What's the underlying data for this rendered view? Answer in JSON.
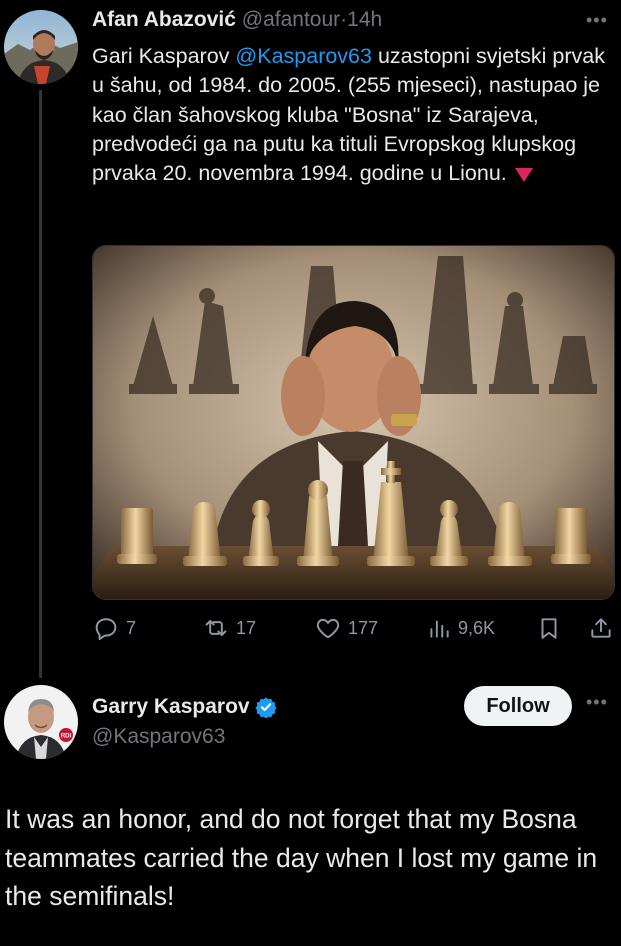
{
  "tweet1": {
    "author_name": "Afan Abazović",
    "handle": "@afantour",
    "separator": "·",
    "time": "14h",
    "more_icon": "ellipsis-icon",
    "text_before_mention": "Gari Kasparov ",
    "mention": "@Kasparov63",
    "text_after_mention": " uzastopni svjetski prvak u šahu, od 1984. do 2005. (255 mjeseci), nastupao je kao član šahovskog kluba \"Bosna\" iz Sarajeva, predvodeći ga na putu ka tituli Evropskog klupskog prvaka 20. novembra 1994. godine u Lionu.",
    "emoji": "red-triangle-down-icon",
    "actions": {
      "replies": "7",
      "reposts": "17",
      "likes": "177",
      "views": "9,6K"
    }
  },
  "tweet2": {
    "author_name": "Garry Kasparov",
    "verified_icon": "verified-badge-icon",
    "handle": "@Kasparov63",
    "follow_label": "Follow",
    "avatar_badge": "RDI",
    "text": "It was an honor, and do not forget that my Bosna teammates carried the day when I lost my game in the semifinals!"
  },
  "colors": {
    "background": "#000000",
    "text": "#e7e9ea",
    "secondary": "#71767b",
    "link": "#1d9bf0",
    "follow_bg": "#eff3f4"
  }
}
